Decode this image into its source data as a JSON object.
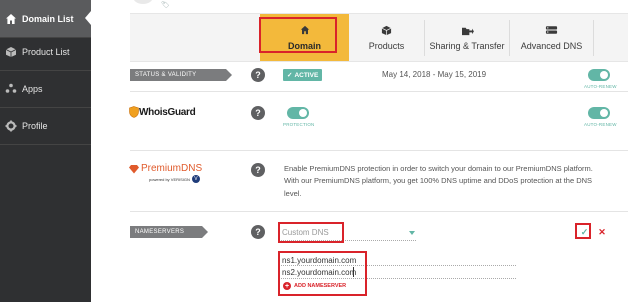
{
  "sidebar": {
    "items": [
      {
        "label": "Domain List",
        "icon": "home-icon"
      },
      {
        "label": "Product List",
        "icon": "box-icon"
      },
      {
        "label": "Apps",
        "icon": "apps-icon"
      },
      {
        "label": "Profile",
        "icon": "gear-icon"
      }
    ]
  },
  "tabs": [
    {
      "label": "Domain",
      "icon": "home-icon"
    },
    {
      "label": "Products",
      "icon": "box-icon"
    },
    {
      "label": "Sharing & Transfer",
      "icon": "share-icon"
    },
    {
      "label": "Advanced DNS",
      "icon": "dns-icon"
    }
  ],
  "status_row": {
    "label": "STATUS & VALIDITY",
    "help": "?",
    "badge": "ACTIVE",
    "dates": "May 14, 2018 - May 15, 2019",
    "autorenew": "AUTO-RENEW"
  },
  "whoisguard_row": {
    "logo": "WhoisGuard",
    "help": "?",
    "toggle_caption": "PROTECTION",
    "autorenew": "AUTO-RENEW"
  },
  "premiumdns_row": {
    "logo": "PremiumDNS",
    "logo_sub": "powered by VERISIGN",
    "help": "?",
    "description_lines": [
      "Enable PremiumDNS protection in order to switch your domain to our PremiumDNS platform.",
      "With our PremiumDNS platform, you get 100% DNS uptime and DDoS protection at the DNS",
      "level."
    ]
  },
  "nameservers_row": {
    "label": "NAMESERVERS",
    "help": "?",
    "select_value": "Custom DNS",
    "ns1": "ns1.yourdomain.com",
    "ns2": "ns2.yourdomain.com",
    "add_label": "ADD NAMESERVER",
    "confirm": "✓",
    "cancel": "✕"
  },
  "colors": {
    "sidebar_bg": "#2f3032",
    "accent_yellow": "#f3b93b",
    "teal": "#62b6a6",
    "highlight_red": "#d9232a"
  }
}
